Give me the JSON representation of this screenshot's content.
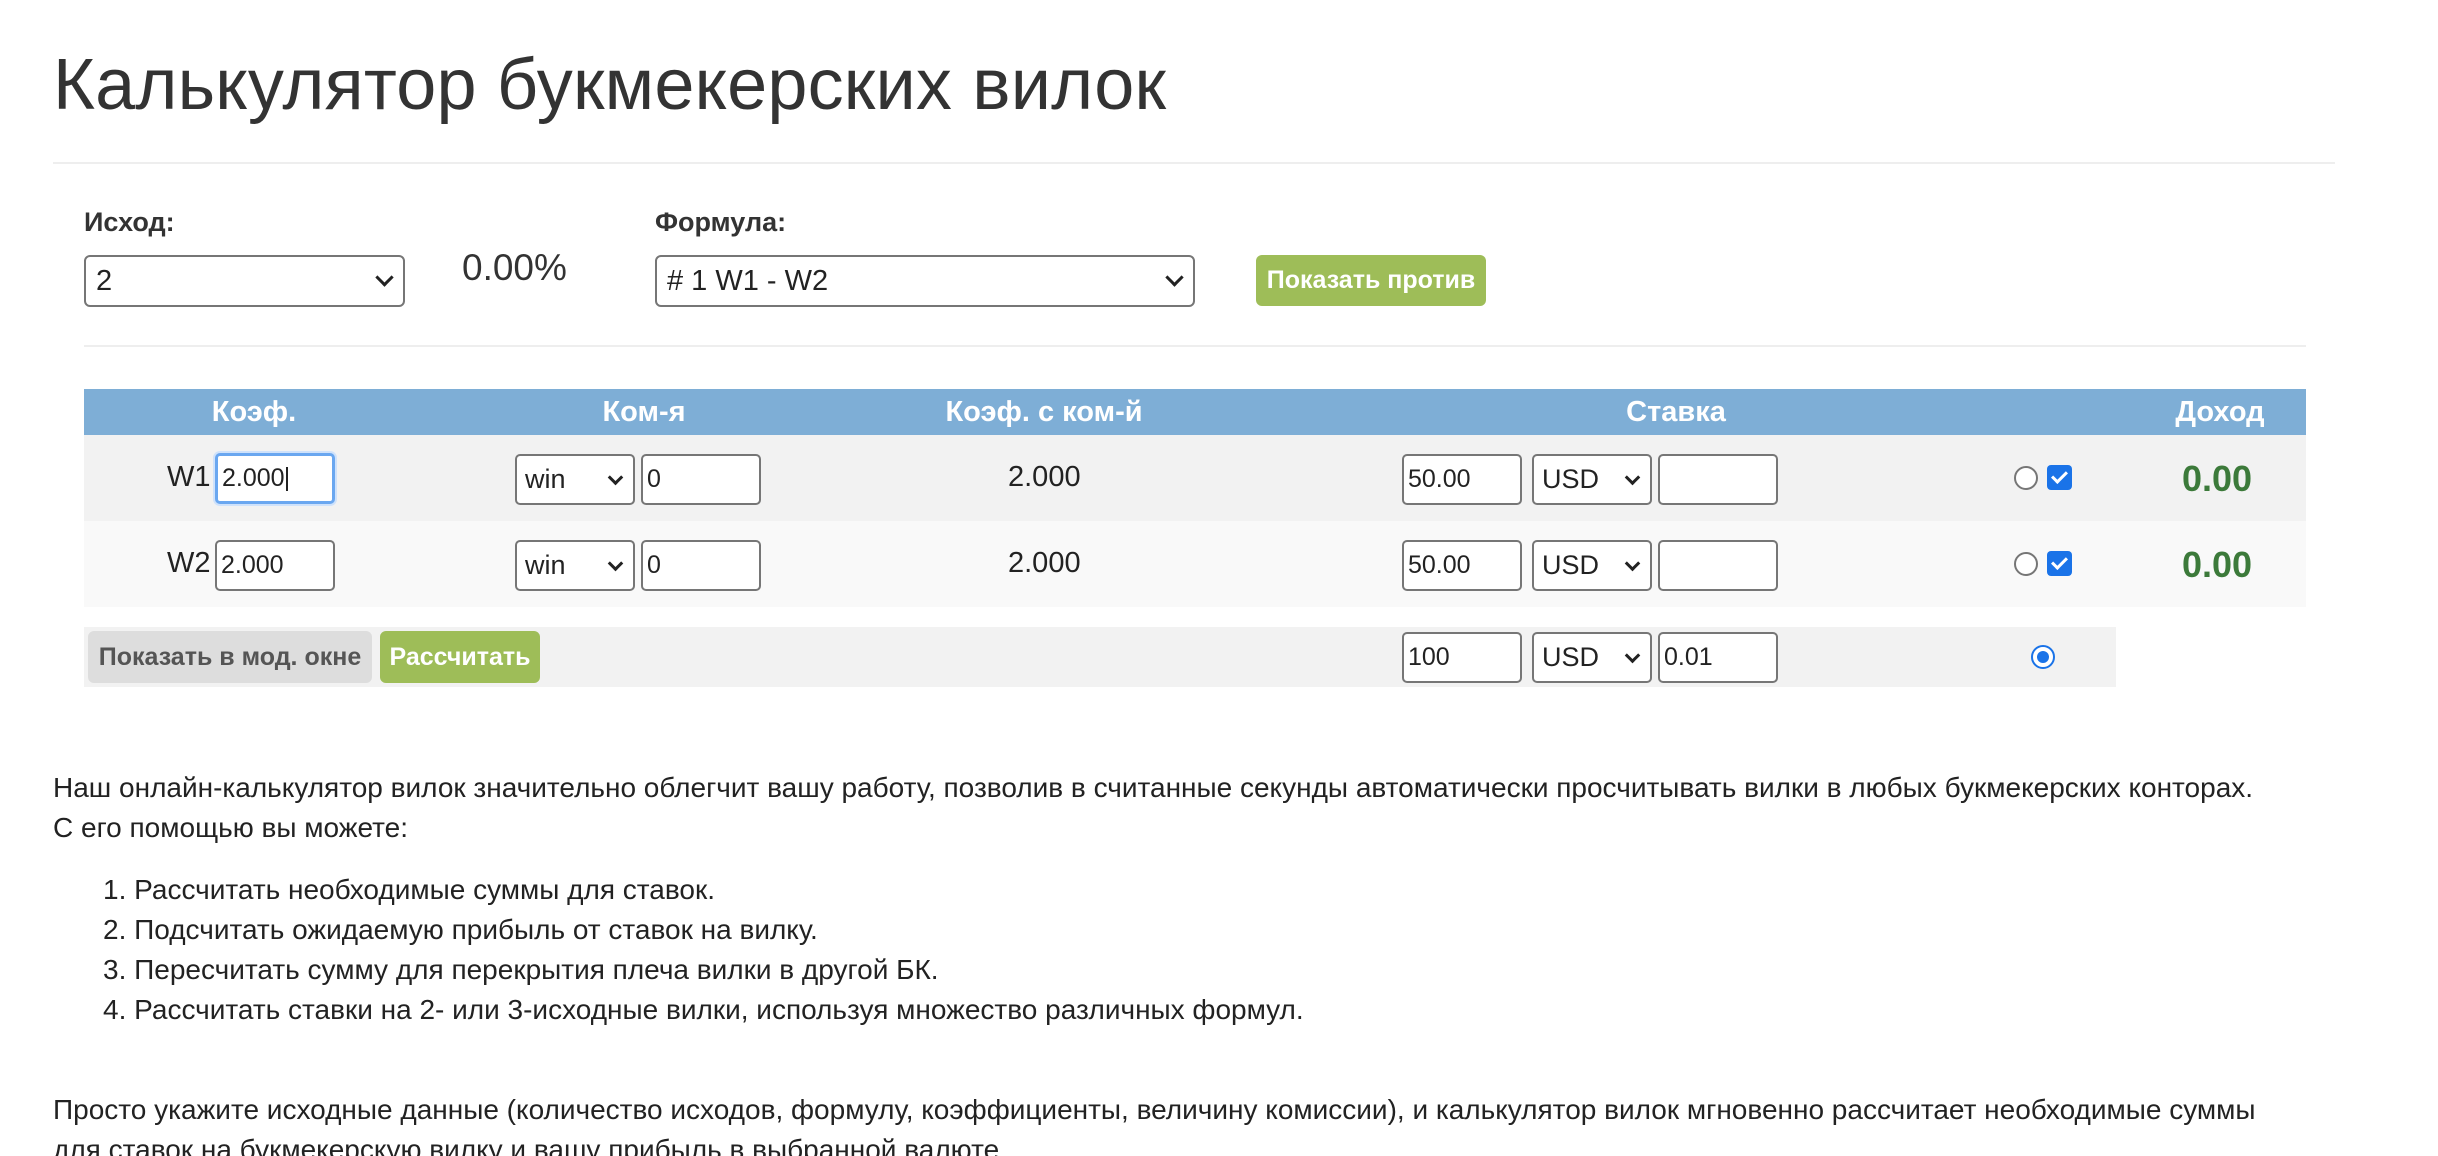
{
  "page": {
    "title": "Калькулятор букмекерских вилок"
  },
  "controls": {
    "outcome_label": "Исход:",
    "outcome_value": "2",
    "percent": "0.00%",
    "formula_label": "Формула:",
    "formula_value": "# 1 W1 - W2",
    "show_against_label": "Показать против"
  },
  "table": {
    "headers": {
      "coef": "Коэф.",
      "commission": "Ком-я",
      "coef_with_commission": "Коэф. с ком-й",
      "stake": "Ставка",
      "income": "Доход"
    },
    "rows": [
      {
        "label": "W1",
        "coef": "2.000",
        "commission_type": "win",
        "commission_value": "0",
        "coef_with_commission": "2.000",
        "stake": "50.00",
        "currency": "USD",
        "extra": "",
        "income": "0.00"
      },
      {
        "label": "W2",
        "coef": "2.000",
        "commission_type": "win",
        "commission_value": "0",
        "coef_with_commission": "2.000",
        "stake": "50.00",
        "currency": "USD",
        "extra": "",
        "income": "0.00"
      }
    ],
    "footer": {
      "show_modal_label": "Показать в мод. окне",
      "calculate_label": "Рассчитать",
      "total_stake": "100",
      "currency": "USD",
      "rounding": "0.01"
    }
  },
  "description": {
    "intro_line1": "Наш онлайн-калькулятор вилок значительно облегчит вашу работу, позволив в считанные секунды автоматически просчитывать вилки в любых букмекерских конторах.",
    "intro_line2": "С его помощью вы можете:",
    "items": [
      "1. Рассчитать необходимые суммы для ставок.",
      "2. Подсчитать ожидаемую прибыль от ставок на вилку.",
      "3. Пересчитать сумму для перекрытия плеча вилки в другой БК.",
      "4. Рассчитать ставки на 2- или 3-исходные вилки, используя множество различных формул."
    ],
    "outro_line1": "Просто укажите исходные данные (количество исходов, формулу, коэффициенты, величину комиссии), и калькулятор вилок мгновенно рассчитает необходимые суммы",
    "outro_line2": "для ставок на букмекерскую вилку и вашу прибыль в выбранной валюте."
  },
  "colors": {
    "header_bg": "#7eaed6",
    "accent_green": "#9ebd58",
    "income_green": "#3c7a3a",
    "checkbox_blue": "#1a73e8"
  }
}
